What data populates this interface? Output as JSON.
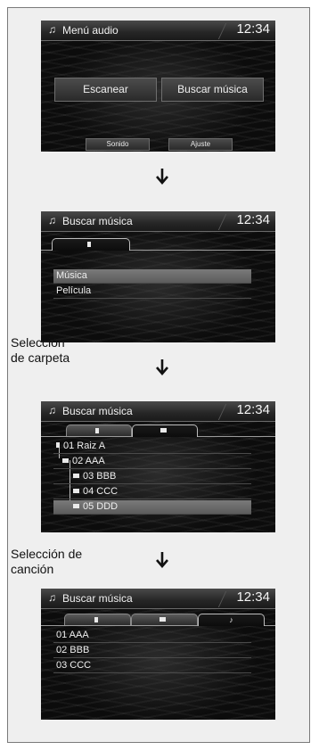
{
  "time": "12:34",
  "screens": {
    "menu": {
      "title": "Menú audio",
      "scan_label": "Escanear",
      "find_music_label": "Buscar música",
      "sound_label": "Sonido",
      "settings_label": "Ajuste"
    },
    "source": {
      "title": "Buscar música",
      "items": [
        "Música",
        "Película"
      ]
    },
    "folders": {
      "title": "Buscar música",
      "items": [
        "01 Raiz A",
        "02 AAA",
        "03 BBB",
        "04 CCC",
        "05 DDD"
      ],
      "selected": "05 DDD"
    },
    "songs": {
      "title": "Buscar música",
      "music_tab_icon": "♪",
      "items": [
        "01 AAA",
        "02 BBB",
        "03 CCC"
      ]
    }
  },
  "captions": {
    "folder_selection": [
      "Selección",
      "de carpeta"
    ],
    "song_selection": [
      "Selección de",
      "canción"
    ]
  },
  "icons": [
    "music-note-icon",
    "sd-card-icon",
    "folder-icon",
    "down-arrow-icon"
  ]
}
